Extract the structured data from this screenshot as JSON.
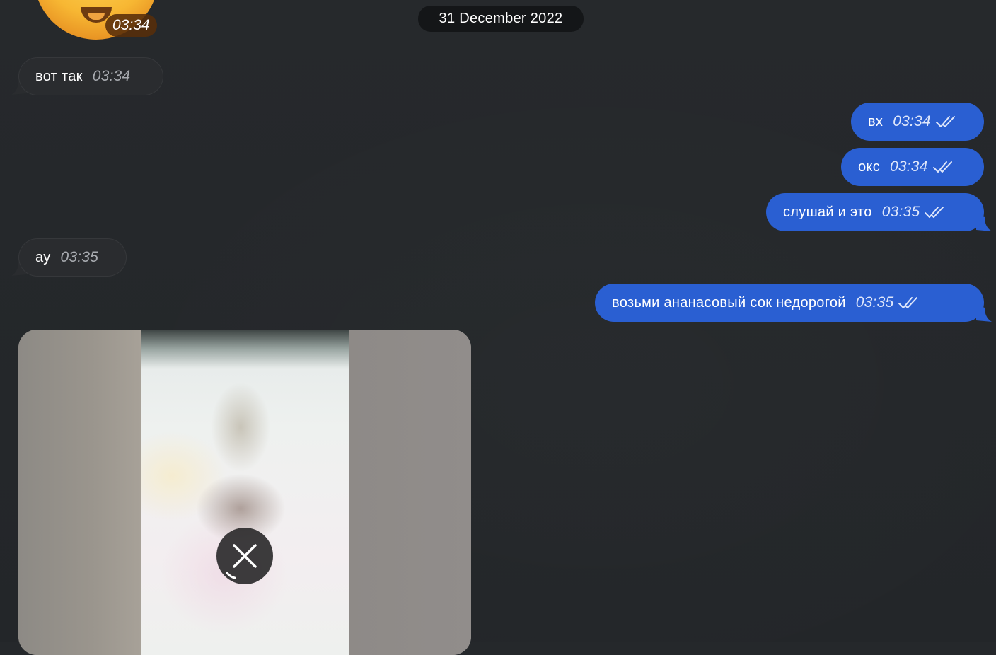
{
  "date_divider": "31 December 2022",
  "sticker": {
    "time": "03:34"
  },
  "messages": [
    {
      "direction": "in",
      "text": "вот так",
      "time": "03:34"
    },
    {
      "direction": "out",
      "text": "вх",
      "time": "03:34",
      "status": "read"
    },
    {
      "direction": "out",
      "text": "окс",
      "time": "03:34",
      "status": "read"
    },
    {
      "direction": "out",
      "text": "слушай и это",
      "time": "03:35",
      "status": "read"
    },
    {
      "direction": "in",
      "text": "ау",
      "time": "03:35"
    },
    {
      "direction": "out",
      "text": "возьми ананасовый сок недорогой",
      "time": "03:35",
      "status": "read"
    }
  ],
  "media": {
    "state": "loading",
    "action_icon": "close-icon"
  },
  "colors": {
    "background": "#25282b",
    "incoming_bubble": "#2a2c2f",
    "outgoing_bubble": "#2a5fd2",
    "date_pill": "#141618"
  }
}
